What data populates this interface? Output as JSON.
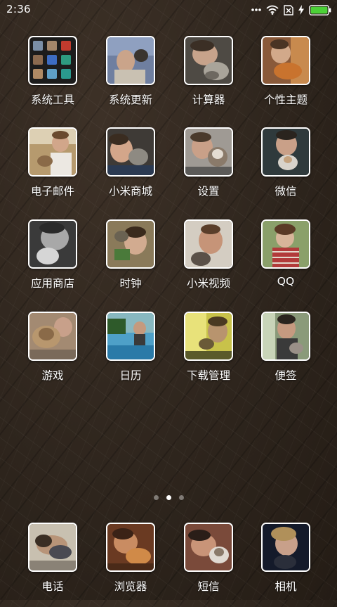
{
  "status_bar": {
    "time": "2:36",
    "battery_color": "#4cd137",
    "icons": [
      "more-dots-icon",
      "wifi-icon",
      "no-sim-icon",
      "charging-bolt-icon",
      "battery-icon"
    ]
  },
  "home": {
    "apps": [
      {
        "label": "系统工具",
        "icon": "folder-icon"
      },
      {
        "label": "系统更新",
        "icon": "photo-icon"
      },
      {
        "label": "计算器",
        "icon": "photo-icon"
      },
      {
        "label": "个性主题",
        "icon": "photo-icon"
      },
      {
        "label": "电子邮件",
        "icon": "photo-icon"
      },
      {
        "label": "小米商城",
        "icon": "photo-icon"
      },
      {
        "label": "设置",
        "icon": "photo-icon"
      },
      {
        "label": "微信",
        "icon": "photo-icon"
      },
      {
        "label": "应用商店",
        "icon": "photo-icon"
      },
      {
        "label": "时钟",
        "icon": "photo-icon"
      },
      {
        "label": "小米视频",
        "icon": "photo-icon"
      },
      {
        "label": "QQ",
        "icon": "photo-icon"
      },
      {
        "label": "游戏",
        "icon": "photo-icon"
      },
      {
        "label": "日历",
        "icon": "photo-icon"
      },
      {
        "label": "下载管理",
        "icon": "photo-icon"
      },
      {
        "label": "便签",
        "icon": "photo-icon"
      }
    ]
  },
  "pager": {
    "page_count": 3,
    "current_page": 2
  },
  "dock": {
    "apps": [
      {
        "label": "电话",
        "icon": "photo-icon"
      },
      {
        "label": "浏览器",
        "icon": "photo-icon"
      },
      {
        "label": "短信",
        "icon": "photo-icon"
      },
      {
        "label": "相机",
        "icon": "photo-icon"
      }
    ]
  }
}
